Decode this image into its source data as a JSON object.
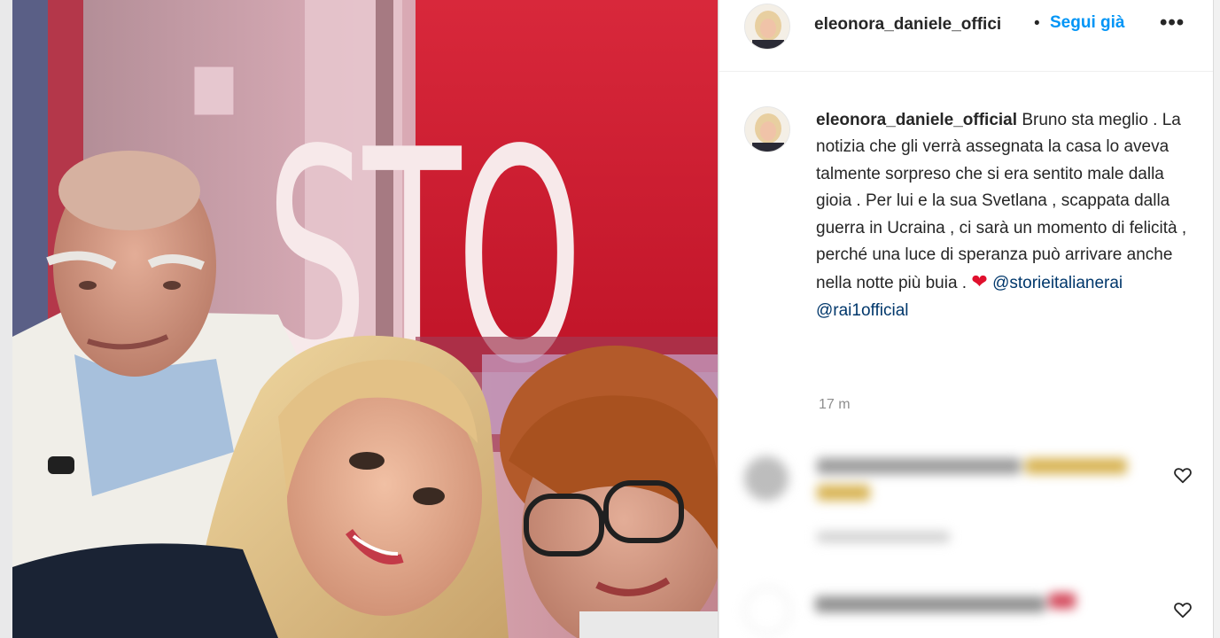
{
  "header": {
    "username": "eleonora_daniele_offici",
    "separator": "•",
    "follow_label": "Segui già",
    "more_label": "•••"
  },
  "caption": {
    "username": "eleonora_daniele_official",
    "text": "Bruno sta meglio . La notizia che gli verrà assegnata la casa lo aveva talmente sorpreso che si era sentito male dalla gioia . Per lui e la sua Svetlana , scappata dalla guerra in Ucraina , ci sarà un momento di felicità , perché una luce di speranza può arrivare anche nella notte più buia .",
    "heart": "❤",
    "mention_1": "@storieitalianerai",
    "mention_2": "@rai1official",
    "time": "17 m"
  },
  "photo": {
    "studio_sign": "STO"
  },
  "comments": [
    {
      "icon": "heart-outline-icon"
    },
    {
      "icon": "heart-outline-icon"
    }
  ],
  "colors": {
    "accent_blue": "#0095f6",
    "mention": "#00376b",
    "heart": "#e0102d"
  }
}
